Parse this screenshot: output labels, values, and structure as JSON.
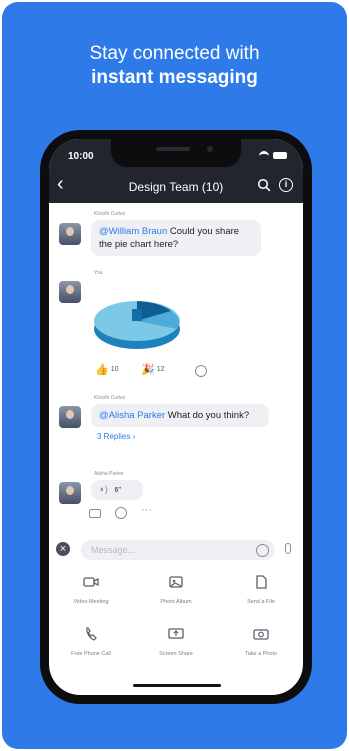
{
  "headline": {
    "line1": "Stay connected with",
    "line2": "instant messaging"
  },
  "status_bar": {
    "time": "10:00"
  },
  "chat_header": {
    "title": "Design Team (10)",
    "back_icon": "chevron-left-icon",
    "search_icon": "search-icon",
    "info_icon": "info-icon"
  },
  "messages": [
    {
      "sender": "Khoshi Curtez",
      "mention": "@William Braun",
      "text": " Could you share the pie chart here?"
    },
    {
      "sender": "You",
      "reactions": [
        {
          "emoji": "👍",
          "count": "10"
        },
        {
          "emoji": "🎉",
          "count": "12"
        }
      ]
    },
    {
      "sender": "Khoshi Curtez",
      "mention": "@Alisha Parker",
      "text": " What do you think?",
      "replies": "3 Replies  ›"
    },
    {
      "sender": "Alisha Parker",
      "audio_label": "6\""
    }
  ],
  "composer": {
    "placeholder": "Message..."
  },
  "toolbar": {
    "items": [
      {
        "label": "Video Meeting",
        "icon": "video-camera-icon"
      },
      {
        "label": "Photo Album",
        "icon": "photo-album-icon"
      },
      {
        "label": "Send a File",
        "icon": "file-icon"
      },
      {
        "label": "Free Phone Call",
        "icon": "phone-icon"
      },
      {
        "label": "Screen Share",
        "icon": "screen-share-icon"
      },
      {
        "label": "Take a Photo",
        "icon": "camera-icon"
      }
    ]
  },
  "colors": {
    "brand_blue": "#2d7ae8",
    "header_dark": "#23252e",
    "bubble": "#eef0f4"
  }
}
